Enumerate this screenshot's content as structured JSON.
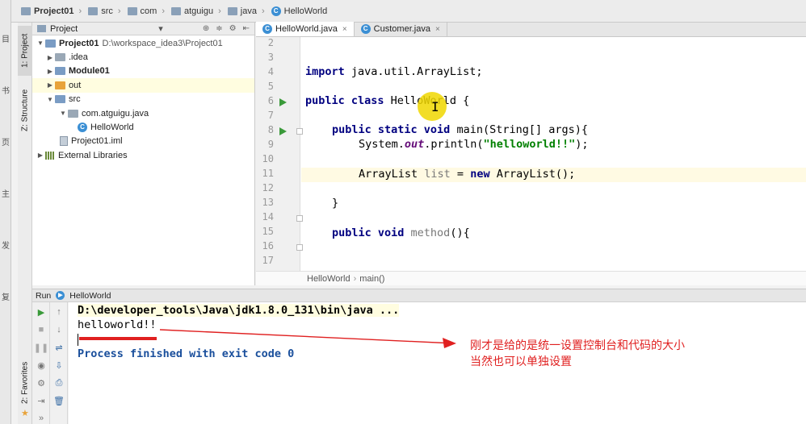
{
  "navbar": {
    "crumbs": [
      "Project01",
      "src",
      "com",
      "atguigu",
      "java",
      "HelloWorld"
    ]
  },
  "outer_strip": [
    "目",
    "书",
    "页",
    "主",
    "发",
    "复"
  ],
  "toolstrip": {
    "project_tab": "1: Project",
    "structure_tab": "Z: Structure",
    "favorites_tab": "2: Favorites"
  },
  "project_panel": {
    "header_label": "Project",
    "header_dropdown": "▾",
    "tree": [
      {
        "label": "Project01",
        "extra": "D:\\workspace_idea3\\Project01",
        "bold": true
      },
      {
        "label": ".idea"
      },
      {
        "label": "Module01",
        "bold": true
      },
      {
        "label": "out"
      },
      {
        "label": "src"
      },
      {
        "label": "com.atguigu.java"
      },
      {
        "label": "HelloWorld"
      },
      {
        "label": "Project01.iml"
      },
      {
        "label": "External Libraries"
      }
    ]
  },
  "editor": {
    "tabs": [
      {
        "label": "HelloWorld.java",
        "active": true
      },
      {
        "label": "Customer.java",
        "active": false
      }
    ],
    "line_numbers": [
      "2",
      "3",
      "4",
      "5",
      "6",
      "7",
      "8",
      "9",
      "10",
      "11",
      "12",
      "13",
      "14",
      "15",
      "16",
      "17"
    ],
    "code": {
      "import_kw": "import",
      "import_rest": " java.util.ArrayList;",
      "public_kw": "public class",
      "class_name": " HelloWorld {",
      "main_kw": "public static void",
      "main_rest": " main(String[] args){",
      "sysout_a": "System.",
      "sysout_out": "out",
      "sysout_b": ".println(",
      "sysout_str": "\"helloworld!!\"",
      "sysout_c": ");",
      "list_a": "ArrayList ",
      "list_var": "list",
      "list_b": " = ",
      "list_new": "new",
      "list_c": " ArrayList();",
      "close_brace": "}",
      "method_kw": "public void",
      "method_name": " method",
      "method_rest": "(){"
    },
    "breadcrumbs": [
      "HelloWorld",
      "main()"
    ]
  },
  "run_panel": {
    "label_run": "Run",
    "label_config": "HelloWorld",
    "console": {
      "path_line": "D:\\developer_tools\\Java\\jdk1.8.0_131\\bin\\java ...",
      "output_line": "helloworld!!",
      "process_line": "Process finished with exit code 0"
    }
  },
  "annotation": {
    "line1": "刚才是给的是统一设置控制台和代码的大小",
    "line2": "当然也可以单独设置",
    "color": "#e02020"
  }
}
